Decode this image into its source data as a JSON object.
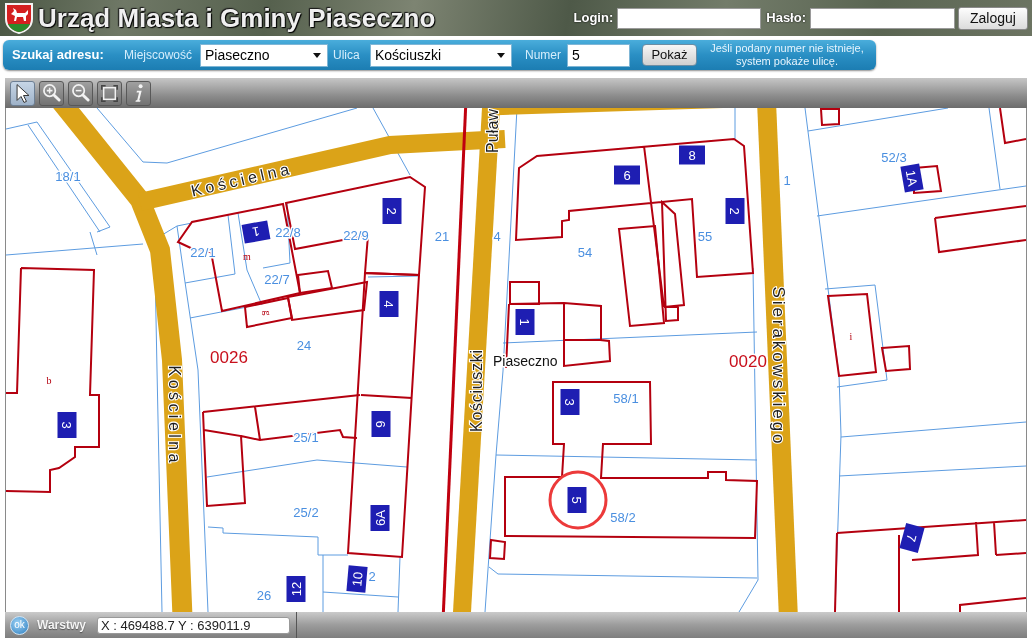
{
  "header": {
    "title": "Urząd Miasta i Gminy Piaseczno",
    "login_label": "Login:",
    "password_label": "Hasło:",
    "login_button": "Zaloguj"
  },
  "search": {
    "title": "Szukaj adresu:",
    "fields": [
      {
        "kind": "select",
        "label": "Miejscowość",
        "value": "Piaseczno"
      },
      {
        "kind": "select",
        "label": "Ulica",
        "value": "Kościuszki"
      },
      {
        "kind": "input",
        "label": "Numer",
        "value": "5"
      }
    ],
    "button": "Pokaż",
    "hint": "Jeśli podany numer nie istnieje,\nsystem pokaże ulicę."
  },
  "toolbar": [
    {
      "kind": "pointer",
      "selected": true
    },
    {
      "kind": "zoom_in",
      "selected": false
    },
    {
      "kind": "zoom_out",
      "selected": false
    },
    {
      "kind": "full_extent",
      "selected": false
    },
    {
      "kind": "info",
      "selected": false
    }
  ],
  "map": {
    "street_labels": [
      "Puław",
      "Kościelna",
      "Kościelna",
      "Kościuszki",
      "Sierakowskiego"
    ],
    "parcel_numbers": [
      "52/3",
      "18/1",
      "1",
      "22/8",
      "22/9",
      "21",
      "4",
      "55",
      "22/1",
      "54",
      "22/7",
      "24",
      "58/1",
      "25/1",
      "25/2",
      "58/2",
      "2",
      "26"
    ],
    "house_numbers": [
      {
        "label": "8",
        "selected": false
      },
      {
        "label": "6",
        "selected": false
      },
      {
        "label": "1A",
        "selected": false
      },
      {
        "label": "2",
        "selected": false
      },
      {
        "label": "2",
        "selected": false
      },
      {
        "label": "1",
        "selected": false
      },
      {
        "label": "4",
        "selected": false
      },
      {
        "label": "1",
        "selected": false
      },
      {
        "label": "3",
        "selected": false
      },
      {
        "label": "3",
        "selected": false
      },
      {
        "label": "6",
        "selected": false
      },
      {
        "label": "5",
        "selected": true
      },
      {
        "label": "6A",
        "selected": false
      },
      {
        "label": "7",
        "selected": false
      },
      {
        "label": "12",
        "selected": false
      },
      {
        "label": "10",
        "selected": false
      }
    ],
    "district_codes": [
      "0026",
      "0020"
    ],
    "place_label": "Piaseczno",
    "building_letters": [
      "m",
      "g",
      "i",
      "b"
    ]
  },
  "status_bar": {
    "layers_toggle": "ok",
    "layers_label": "Warstwy",
    "coordinates": "X : 469488.7 Y : 639011.9"
  }
}
